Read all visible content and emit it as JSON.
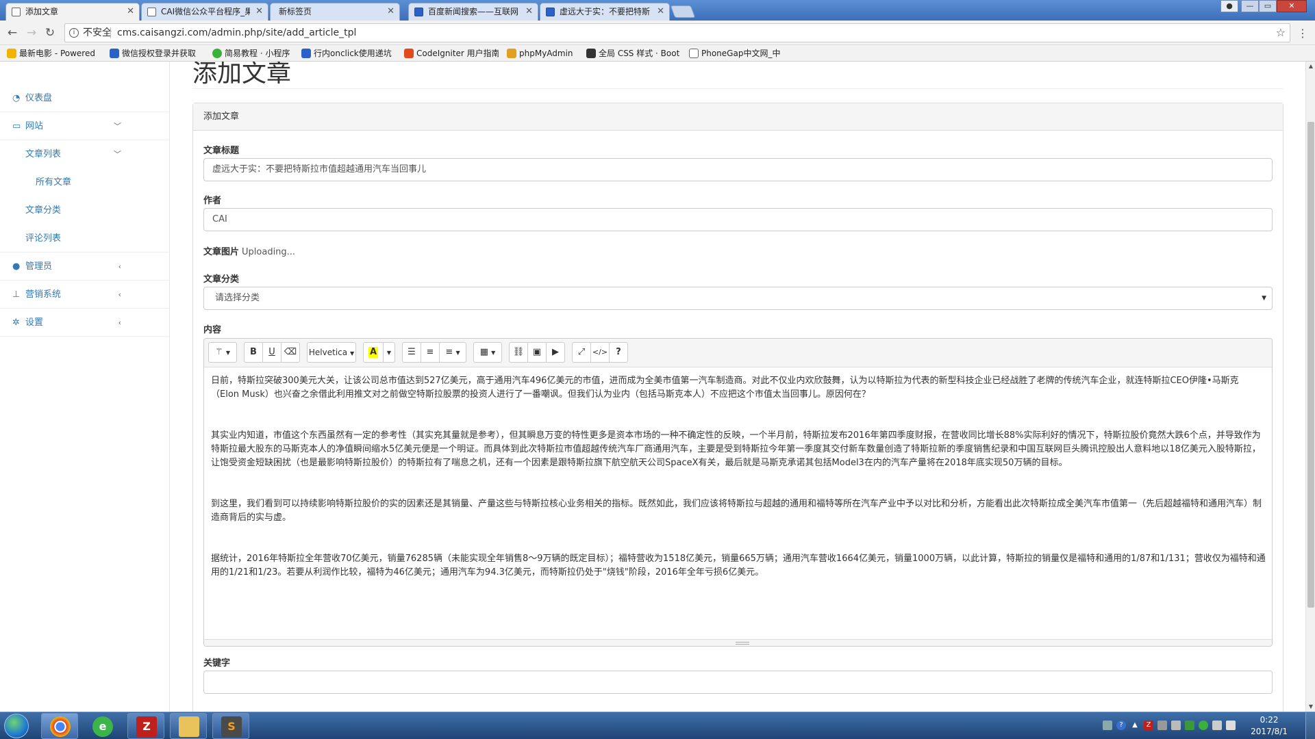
{
  "browser": {
    "tabs": [
      {
        "title": "添加文章"
      },
      {
        "title": "CAI微信公众平台程序_果"
      },
      {
        "title": "新标签页"
      },
      {
        "title": "百度新闻搜索——互联网"
      },
      {
        "title": "虚远大于实：不要把特斯"
      }
    ],
    "address": {
      "insecure_label": "不安全",
      "url": "cms.caisangzi.com/admin.php/site/add_article_tpl"
    },
    "bookmarks": [
      {
        "label": "最新电影 - Powered",
        "color": "#f0b400"
      },
      {
        "label": "微信授权登录并获取",
        "color": "#2a62c8"
      },
      {
        "label": "简易教程 · 小程序",
        "color": "#3cb03c"
      },
      {
        "label": "行内onclick使用递坑",
        "color": "#2a62c8"
      },
      {
        "label": "CodeIgniter 用户指南",
        "color": "#e04a1d"
      },
      {
        "label": "phpMyAdmin",
        "color": "#e0a020"
      },
      {
        "label": "全局 CSS 样式 · Boot",
        "color": "#333333"
      },
      {
        "label": "PhoneGap中文网_中",
        "color": "#666666"
      }
    ]
  },
  "sidebar": {
    "items": [
      {
        "label": "仪表盘",
        "icon": "dashboard-icon"
      },
      {
        "label": "网站",
        "icon": "monitor-icon",
        "caret": "﹀"
      },
      {
        "label": "文章列表",
        "caret": "﹀"
      },
      {
        "label": "所有文章"
      },
      {
        "label": "文章分类"
      },
      {
        "label": "评论列表"
      },
      {
        "label": "管理员",
        "icon": "user-icon",
        "caret": "‹"
      },
      {
        "label": "营销系统",
        "icon": "sitemap-icon",
        "caret": "‹"
      },
      {
        "label": "设置",
        "icon": "gear-icon",
        "caret": "‹"
      }
    ]
  },
  "main": {
    "page_title": "添加文章",
    "panel_title": "添加文章",
    "fields": {
      "title_label": "文章标题",
      "title_value": "虚远大于实：不要把特斯拉市值超越通用汽车当回事儿",
      "author_label": "作者",
      "author_value": "CAI",
      "image_label": "文章图片",
      "image_status": "Uploading...",
      "category_label": "文章分类",
      "category_selected": "请选择分类",
      "content_label": "内容",
      "keywords_label": "关键字",
      "keywords_value": ""
    },
    "toolbar": {
      "font_name": "Helvetica",
      "highlight_letter": "A",
      "bold": "B",
      "underline": "U",
      "help": "?",
      "code": "</>"
    },
    "content_paragraphs": [
      "日前，特斯拉突破300美元大关，让该公司总市值达到527亿美元，高于通用汽车496亿美元的市值，进而成为全美市值第一汽车制造商。对此不仅业内欢欣鼓舞，认为以特斯拉为代表的新型科技企业已经战胜了老牌的传统汽车企业，就连特斯拉CEO伊隆•马斯克（Elon Musk）也兴奋之余借此利用推文对之前做空特斯拉股票的投资人进行了一番嘲讽。但我们认为业内（包括马斯克本人）不应把这个市值太当回事儿。原因何在？",
      "其实业内知道，市值这个东西虽然有一定的参考性（其实充其量就是参考），但其瞬息万变的特性更多是资本市场的一种不确定性的反映，一个半月前，特斯拉发布2016年第四季度财报，在营收同比增长88%实际利好的情况下，特斯拉股价竟然大跌6个点，并导致作为特斯拉最大股东的马斯克本人的净值瞬间缩水5亿美元便是一个明证。而具体到此次特斯拉市值超越传统汽车厂商通用汽车，主要是受到特斯拉今年第一季度其交付新车数量创造了特斯拉新的季度销售纪录和中国互联网巨头腾讯控股出人意料地以18亿美元入股特斯拉，让饱受资金短缺困扰（也是最影响特斯拉股价）的特斯拉有了喘息之机，还有一个因素是跟特斯拉旗下航空航天公司SpaceX有关，最后就是马斯克承诺其包括Model3在内的汽车产量将在2018年底实现50万辆的目标。",
      "到这里，我们看到可以持续影响特斯拉股价的实的因素还是其销量、产量这些与特斯拉核心业务相关的指标。既然如此，我们应该将特斯拉与超越的通用和福特等所在汽车产业中予以对比和分析，方能看出此次特斯拉成全美汽车市值第一（先后超越福特和通用汽车）制造商背后的实与虚。",
      "据统计，2016年特斯拉全年营收70亿美元，销量76285辆（未能实现全年销售8～9万辆的既定目标）；福特营收为1518亿美元，销量665万辆；通用汽车营收1664亿美元，销量1000万辆，以此计算，特斯拉的销量仅是福特和通用的1/87和1/131；营收仅为福特和通用的1/21和1/23。若要从利润作比较，福特为46亿美元；通用汽车为94.3亿美元，而特斯拉仍处于\"烧钱\"阶段，2016年全年亏损6亿美元。"
    ]
  },
  "taskbar": {
    "clock_time": "0:22",
    "clock_date": "2017/8/1"
  }
}
